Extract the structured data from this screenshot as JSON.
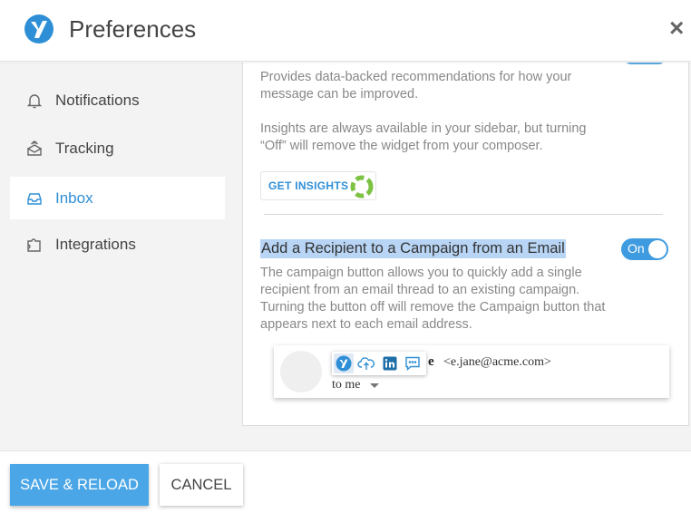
{
  "header": {
    "title": "Preferences",
    "logo_icon": "yesware-logo-icon",
    "close_label": "×"
  },
  "sidebar": {
    "items": [
      {
        "label": "Notifications",
        "icon": "bell-icon"
      },
      {
        "label": "Tracking",
        "icon": "tracking-icon"
      },
      {
        "label": "Inbox",
        "icon": "inbox-icon",
        "active": true
      },
      {
        "label": "Integrations",
        "icon": "puzzle-icon"
      }
    ]
  },
  "insights": {
    "description_1": "Provides data-backed recommendations for how your",
    "description_2": "message can be improved.",
    "note_1": "Insights are always available in your sidebar, but turning",
    "note_2": "“Off” will remove the widget from your composer.",
    "button_label": "GET INSIGHTS"
  },
  "campaign": {
    "title": "Add a Recipient to a Campaign from an Email",
    "toggle_label": "On",
    "desc_1": "The campaign button allows you to quickly add a single",
    "desc_2": "recipient from an email thread to an existing campaign.",
    "desc_3": "Turning the button off will remove the Campaign button that",
    "desc_4": "appears next to each email address."
  },
  "email_preview": {
    "sender_tail": "e",
    "sender_email": "<e.jane@acme.com>",
    "to_label": "to me"
  },
  "footer": {
    "save_label": "SAVE & RELOAD",
    "cancel_label": "CANCEL"
  },
  "colors": {
    "accent": "#2f8fd6",
    "save_button": "#4aa6e6",
    "highlight": "#b8d5f5",
    "toggle_on": "#3f9be0"
  }
}
